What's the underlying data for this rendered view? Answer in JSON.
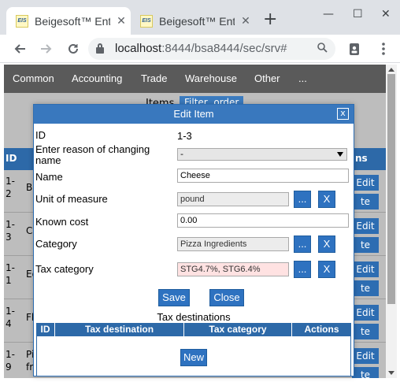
{
  "browser": {
    "tabs": [
      {
        "title": "Beigesoft™ Enterprise",
        "favicon": "EIS"
      },
      {
        "title": "Beigesoft™ Enterprise",
        "favicon": "EIS"
      }
    ],
    "new_tab": "+",
    "window_controls": {
      "minimize": "—",
      "maximize": "☐",
      "close": "✕"
    },
    "url_host": "localhost",
    "url_rest": ":8444/bsa8444/sec/srv#"
  },
  "menu": [
    "Common",
    "Accounting",
    "Trade",
    "Warehouse",
    "Other",
    "..."
  ],
  "background": {
    "items_title": "Items",
    "filter_label": "Filter, order",
    "header_id": "ID",
    "header_actions": "ns",
    "rows": [
      {
        "id": "1-\n2",
        "name": "Bac",
        "edit": "Edit",
        "del": "te"
      },
      {
        "id": "1-\n3",
        "name": "Che",
        "edit": "Edit",
        "del": "te"
      },
      {
        "id": "1-\n1",
        "name": "Egg",
        "edit": "Edit",
        "del": "te"
      },
      {
        "id": "1-\n4",
        "name": "Flou",
        "edit": "Edit",
        "del": "te"
      },
      {
        "id": "1-\n9",
        "name": "Pizz\nfroz",
        "edit": "Edit",
        "del": "te"
      }
    ]
  },
  "dialog": {
    "title": "Edit Item",
    "close": "x",
    "id_label": "ID",
    "id_value": "1-3",
    "reason_label": "Enter reason of changing name",
    "reason_value": "-",
    "name_label": "Name",
    "name_value": "Cheese",
    "uom_label": "Unit of measure",
    "uom_value": "pound",
    "cost_label": "Known cost",
    "cost_value": "0.00",
    "category_label": "Category",
    "category_value": "Pizza Ingredients",
    "taxcat_label": "Tax category",
    "taxcat_value": "STG4.7%, STG6.4%",
    "picker": "...",
    "clear": "X",
    "save": "Save",
    "close_btn": "Close",
    "tax_title": "Tax destinations",
    "tax_columns": [
      "ID",
      "Tax destination",
      "Tax category",
      "Actions"
    ],
    "new_btn": "New"
  }
}
